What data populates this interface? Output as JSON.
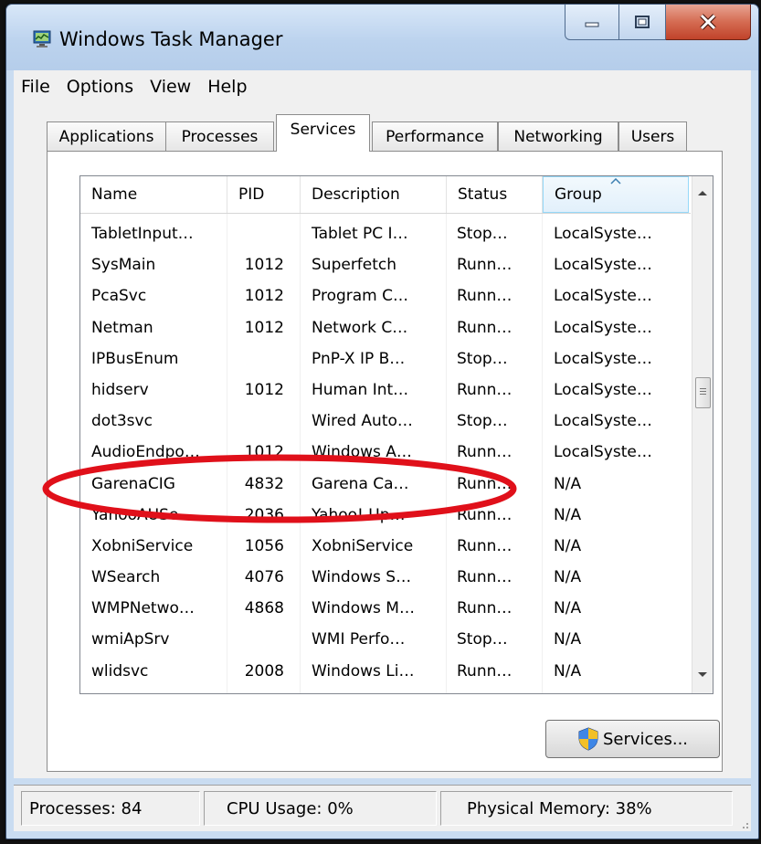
{
  "window": {
    "title": "Windows Task Manager"
  },
  "menu": [
    "File",
    "Options",
    "View",
    "Help"
  ],
  "tabs": [
    "Applications",
    "Processes",
    "Services",
    "Performance",
    "Networking",
    "Users"
  ],
  "active_tab": "Services",
  "columns": [
    "Name",
    "PID",
    "Description",
    "Status",
    "Group"
  ],
  "sorted_column": "Group",
  "rows": [
    [
      "TabletInput…",
      "",
      "Tablet PC I…",
      "Stop…",
      "LocalSyste…"
    ],
    [
      "SysMain",
      "1012",
      "Superfetch",
      "Runn…",
      "LocalSyste…"
    ],
    [
      "PcaSvc",
      "1012",
      "Program C…",
      "Runn…",
      "LocalSyste…"
    ],
    [
      "Netman",
      "1012",
      "Network C…",
      "Runn…",
      "LocalSyste…"
    ],
    [
      "IPBusEnum",
      "",
      "PnP-X IP B…",
      "Stop…",
      "LocalSyste…"
    ],
    [
      "hidserv",
      "1012",
      "Human Int…",
      "Runn…",
      "LocalSyste…"
    ],
    [
      "dot3svc",
      "",
      "Wired Auto…",
      "Stop…",
      "LocalSyste…"
    ],
    [
      "AudioEndpo…",
      "1012",
      "Windows A…",
      "Runn…",
      "LocalSyste…"
    ],
    [
      "GarenaCIG",
      "4832",
      "Garena Ca…",
      "Runn…",
      "N/A"
    ],
    [
      "YahooAUSe…",
      "2036",
      "Yahoo! Up…",
      "Runn…",
      "N/A"
    ],
    [
      "XobniService",
      "1056",
      "XobniService",
      "Runn…",
      "N/A"
    ],
    [
      "WSearch",
      "4076",
      "Windows S…",
      "Runn…",
      "N/A"
    ],
    [
      "WMPNetwo…",
      "4868",
      "Windows M…",
      "Runn…",
      "N/A"
    ],
    [
      "wmiApSrv",
      "",
      "WMI Perfo…",
      "Stop…",
      "N/A"
    ],
    [
      "wlidsvc",
      "2008",
      "Windows Li…",
      "Runn…",
      "N/A"
    ]
  ],
  "highlighted_row": "GarenaCIG",
  "services_button": "Services...",
  "status": {
    "processes": "Processes: 84",
    "cpu": "CPU Usage: 0%",
    "memory": "Physical Memory: 38%"
  },
  "colors": {
    "annotation": "#e0101a",
    "sorted_header": "#e2f0fb"
  }
}
